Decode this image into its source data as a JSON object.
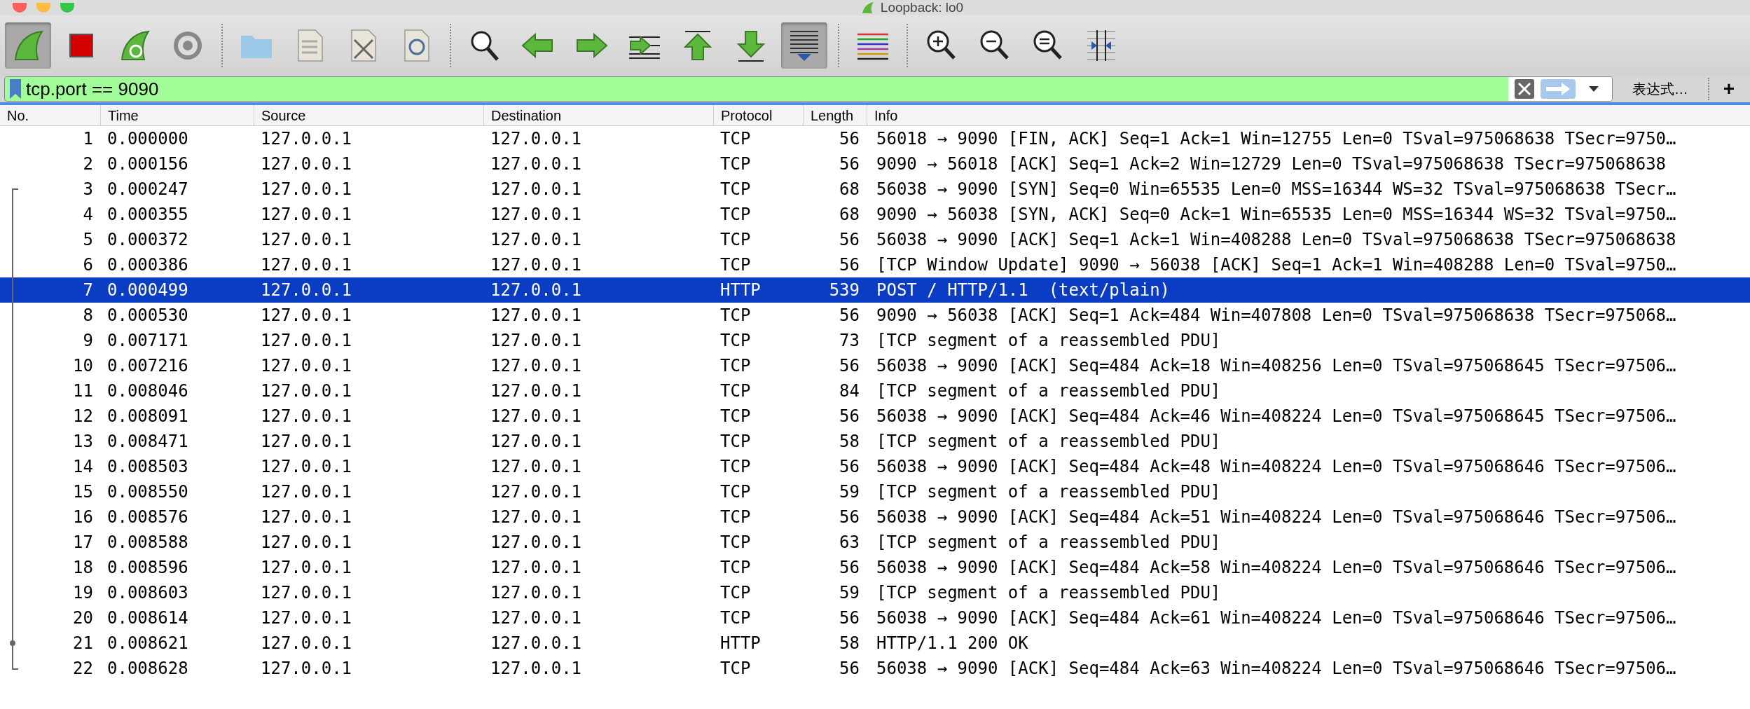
{
  "window": {
    "title": "Loopback: lo0"
  },
  "toolbar": [
    {
      "kind": "fin",
      "pressed": true
    },
    {
      "kind": "stop",
      "pressed": false
    },
    {
      "kind": "restart",
      "pressed": false
    },
    {
      "kind": "gear",
      "pressed": false
    },
    {
      "kind": "separator"
    },
    {
      "kind": "folder",
      "pressed": false
    },
    {
      "kind": "file",
      "pressed": false
    },
    {
      "kind": "fileclose",
      "pressed": false
    },
    {
      "kind": "filereload",
      "pressed": false
    },
    {
      "kind": "separator"
    },
    {
      "kind": "search",
      "pressed": false
    },
    {
      "kind": "back",
      "pressed": false
    },
    {
      "kind": "forward",
      "pressed": false
    },
    {
      "kind": "goto",
      "pressed": false
    },
    {
      "kind": "first",
      "pressed": false
    },
    {
      "kind": "last",
      "pressed": false
    },
    {
      "kind": "autoscroll",
      "pressed": true
    },
    {
      "kind": "separator"
    },
    {
      "kind": "colorize",
      "pressed": false
    },
    {
      "kind": "separator"
    },
    {
      "kind": "zoomin",
      "pressed": false
    },
    {
      "kind": "zoomout",
      "pressed": false
    },
    {
      "kind": "zoomreset",
      "pressed": false
    },
    {
      "kind": "resize",
      "pressed": false
    }
  ],
  "filter": {
    "value": "tcp.port == 9090",
    "expression_button": "表达式…",
    "add_button": "+"
  },
  "table": {
    "columns": [
      "No.",
      "Time",
      "Source",
      "Destination",
      "Protocol",
      "Length",
      "Info"
    ],
    "rows": [
      {
        "no": "1",
        "time": "0.000000",
        "source": "127.0.0.1",
        "destination": "127.0.0.1",
        "protocol": "TCP",
        "length": "56",
        "info": "56018 → 9090 [FIN, ACK] Seq=1 Ack=1 Win=12755 Len=0 TSval=975068638 TSecr=9750…",
        "selected": false
      },
      {
        "no": "2",
        "time": "0.000156",
        "source": "127.0.0.1",
        "destination": "127.0.0.1",
        "protocol": "TCP",
        "length": "56",
        "info": "9090 → 56018 [ACK] Seq=1 Ack=2 Win=12729 Len=0 TSval=975068638 TSecr=975068638",
        "selected": false
      },
      {
        "no": "3",
        "time": "0.000247",
        "source": "127.0.0.1",
        "destination": "127.0.0.1",
        "protocol": "TCP",
        "length": "68",
        "info": "56038 → 9090 [SYN] Seq=0 Win=65535 Len=0 MSS=16344 WS=32 TSval=975068638 TSecr…",
        "selected": false
      },
      {
        "no": "4",
        "time": "0.000355",
        "source": "127.0.0.1",
        "destination": "127.0.0.1",
        "protocol": "TCP",
        "length": "68",
        "info": "9090 → 56038 [SYN, ACK] Seq=0 Ack=1 Win=65535 Len=0 MSS=16344 WS=32 TSval=9750…",
        "selected": false
      },
      {
        "no": "5",
        "time": "0.000372",
        "source": "127.0.0.1",
        "destination": "127.0.0.1",
        "protocol": "TCP",
        "length": "56",
        "info": "56038 → 9090 [ACK] Seq=1 Ack=1 Win=408288 Len=0 TSval=975068638 TSecr=975068638",
        "selected": false
      },
      {
        "no": "6",
        "time": "0.000386",
        "source": "127.0.0.1",
        "destination": "127.0.0.1",
        "protocol": "TCP",
        "length": "56",
        "info": "[TCP Window Update] 9090 → 56038 [ACK] Seq=1 Ack=1 Win=408288 Len=0 TSval=9750…",
        "selected": false
      },
      {
        "no": "7",
        "time": "0.000499",
        "source": "127.0.0.1",
        "destination": "127.0.0.1",
        "protocol": "HTTP",
        "length": "539",
        "info": "POST / HTTP/1.1  (text/plain)",
        "selected": true
      },
      {
        "no": "8",
        "time": "0.000530",
        "source": "127.0.0.1",
        "destination": "127.0.0.1",
        "protocol": "TCP",
        "length": "56",
        "info": "9090 → 56038 [ACK] Seq=1 Ack=484 Win=407808 Len=0 TSval=975068638 TSecr=975068…",
        "selected": false
      },
      {
        "no": "9",
        "time": "0.007171",
        "source": "127.0.0.1",
        "destination": "127.0.0.1",
        "protocol": "TCP",
        "length": "73",
        "info": "[TCP segment of a reassembled PDU]",
        "selected": false
      },
      {
        "no": "10",
        "time": "0.007216",
        "source": "127.0.0.1",
        "destination": "127.0.0.1",
        "protocol": "TCP",
        "length": "56",
        "info": "56038 → 9090 [ACK] Seq=484 Ack=18 Win=408256 Len=0 TSval=975068645 TSecr=97506…",
        "selected": false
      },
      {
        "no": "11",
        "time": "0.008046",
        "source": "127.0.0.1",
        "destination": "127.0.0.1",
        "protocol": "TCP",
        "length": "84",
        "info": "[TCP segment of a reassembled PDU]",
        "selected": false
      },
      {
        "no": "12",
        "time": "0.008091",
        "source": "127.0.0.1",
        "destination": "127.0.0.1",
        "protocol": "TCP",
        "length": "56",
        "info": "56038 → 9090 [ACK] Seq=484 Ack=46 Win=408224 Len=0 TSval=975068645 TSecr=97506…",
        "selected": false
      },
      {
        "no": "13",
        "time": "0.008471",
        "source": "127.0.0.1",
        "destination": "127.0.0.1",
        "protocol": "TCP",
        "length": "58",
        "info": "[TCP segment of a reassembled PDU]",
        "selected": false
      },
      {
        "no": "14",
        "time": "0.008503",
        "source": "127.0.0.1",
        "destination": "127.0.0.1",
        "protocol": "TCP",
        "length": "56",
        "info": "56038 → 9090 [ACK] Seq=484 Ack=48 Win=408224 Len=0 TSval=975068646 TSecr=97506…",
        "selected": false
      },
      {
        "no": "15",
        "time": "0.008550",
        "source": "127.0.0.1",
        "destination": "127.0.0.1",
        "protocol": "TCP",
        "length": "59",
        "info": "[TCP segment of a reassembled PDU]",
        "selected": false
      },
      {
        "no": "16",
        "time": "0.008576",
        "source": "127.0.0.1",
        "destination": "127.0.0.1",
        "protocol": "TCP",
        "length": "56",
        "info": "56038 → 9090 [ACK] Seq=484 Ack=51 Win=408224 Len=0 TSval=975068646 TSecr=97506…",
        "selected": false
      },
      {
        "no": "17",
        "time": "0.008588",
        "source": "127.0.0.1",
        "destination": "127.0.0.1",
        "protocol": "TCP",
        "length": "63",
        "info": "[TCP segment of a reassembled PDU]",
        "selected": false
      },
      {
        "no": "18",
        "time": "0.008596",
        "source": "127.0.0.1",
        "destination": "127.0.0.1",
        "protocol": "TCP",
        "length": "56",
        "info": "56038 → 9090 [ACK] Seq=484 Ack=58 Win=408224 Len=0 TSval=975068646 TSecr=97506…",
        "selected": false
      },
      {
        "no": "19",
        "time": "0.008603",
        "source": "127.0.0.1",
        "destination": "127.0.0.1",
        "protocol": "TCP",
        "length": "59",
        "info": "[TCP segment of a reassembled PDU]",
        "selected": false
      },
      {
        "no": "20",
        "time": "0.008614",
        "source": "127.0.0.1",
        "destination": "127.0.0.1",
        "protocol": "TCP",
        "length": "56",
        "info": "56038 → 9090 [ACK] Seq=484 Ack=61 Win=408224 Len=0 TSval=975068646 TSecr=97506…",
        "selected": false
      },
      {
        "no": "21",
        "time": "0.008621",
        "source": "127.0.0.1",
        "destination": "127.0.0.1",
        "protocol": "HTTP",
        "length": "58",
        "info": "HTTP/1.1 200 OK",
        "selected": false
      },
      {
        "no": "22",
        "time": "0.008628",
        "source": "127.0.0.1",
        "destination": "127.0.0.1",
        "protocol": "TCP",
        "length": "56",
        "info": "56038 → 9090 [ACK] Seq=484 Ack=63 Win=408224 Len=0 TSval=975068646 TSecr=97506…",
        "selected": false
      }
    ]
  }
}
